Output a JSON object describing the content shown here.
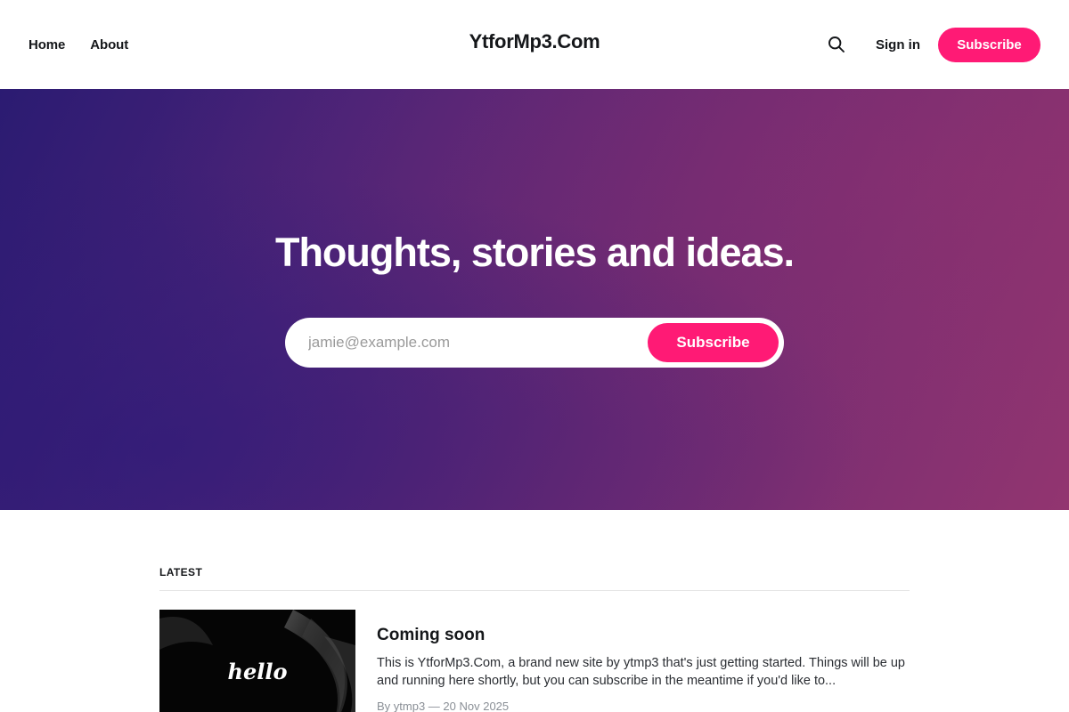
{
  "header": {
    "nav": [
      "Home",
      "About"
    ],
    "site_title": "YtforMp3.Com",
    "search_icon": "search-icon",
    "signin_label": "Sign in",
    "subscribe_label": "Subscribe"
  },
  "hero": {
    "title": "Thoughts, stories and ideas.",
    "email_placeholder": "jamie@example.com",
    "subscribe_label": "Subscribe"
  },
  "latest": {
    "label": "LATEST",
    "posts": [
      {
        "title": "Coming soon",
        "excerpt": "This is YtforMp3.Com, a brand new site by ytmp3 that's just getting started. Things will be up and running here shortly, but you can subscribe in the meantime if you'd like to...",
        "meta": "By ytmp3 — 20 Nov 2025",
        "thumbnail_text": "hello"
      }
    ]
  },
  "colors": {
    "accent": "#ff1a75",
    "hero_gradient_start": "#2b1b72",
    "hero_gradient_end": "#923570"
  }
}
